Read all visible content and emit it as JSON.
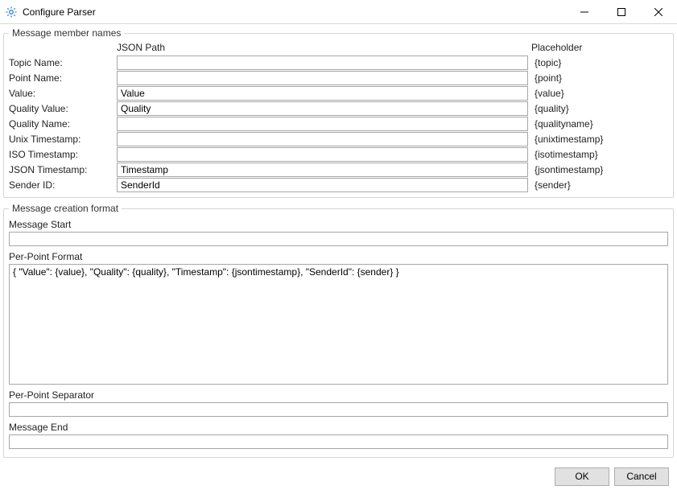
{
  "window": {
    "title": "Configure Parser"
  },
  "section1": {
    "legend": "Message member names",
    "headers": {
      "jsonpath": "JSON Path",
      "placeholder": "Placeholder"
    },
    "rows": [
      {
        "label": "Topic Name:",
        "value": "",
        "placeholder": "{topic}"
      },
      {
        "label": "Point Name:",
        "value": "",
        "placeholder": "{point}"
      },
      {
        "label": "Value:",
        "value": "Value",
        "placeholder": "{value}"
      },
      {
        "label": "Quality Value:",
        "value": "Quality",
        "placeholder": "{quality}"
      },
      {
        "label": "Quality Name:",
        "value": "",
        "placeholder": "{qualityname}"
      },
      {
        "label": "Unix Timestamp:",
        "value": "",
        "placeholder": "{unixtimestamp}"
      },
      {
        "label": "ISO Timestamp:",
        "value": "",
        "placeholder": "{isotimestamp}"
      },
      {
        "label": "JSON Timestamp:",
        "value": "Timestamp",
        "placeholder": "{jsontimestamp}"
      },
      {
        "label": "Sender ID:",
        "value": "SenderId",
        "placeholder": "{sender}"
      }
    ]
  },
  "section2": {
    "legend": "Message creation format",
    "message_start_label": "Message Start",
    "message_start_value": "",
    "ppf_label": "Per-Point Format",
    "ppf_value": "{ \"Value\": {value}, \"Quality\": {quality}, \"Timestamp\": {jsontimestamp}, \"SenderId\": {sender} }",
    "pps_label": "Per-Point Separator",
    "pps_value": "",
    "message_end_label": "Message End",
    "message_end_value": ""
  },
  "buttons": {
    "ok": "OK",
    "cancel": "Cancel"
  }
}
